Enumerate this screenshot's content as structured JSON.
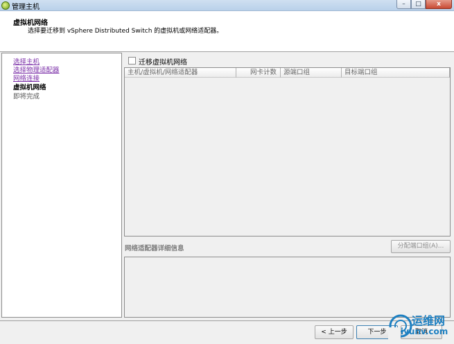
{
  "window": {
    "title": "管理主机",
    "controls": {
      "minimize": "–",
      "maximize": "□",
      "close": "x"
    }
  },
  "header": {
    "title": "虚拟机网络",
    "subtitle": "选择要迁移到 vSphere Distributed Switch 的虚拟机或网络适配器。"
  },
  "nav": {
    "items": [
      {
        "label": "选择主机",
        "state": "completed"
      },
      {
        "label": "选择物理适配器",
        "state": "completed"
      },
      {
        "label": "网络连接",
        "state": "completed"
      },
      {
        "label": "虚拟机网络",
        "state": "current"
      },
      {
        "label": "即将完成",
        "state": "upcoming"
      }
    ]
  },
  "migrate_checkbox": {
    "label": "迁移虚拟机网络",
    "checked": false
  },
  "table": {
    "columns": [
      "主机/虚拟机/网络适配器",
      "网卡计数",
      "源端口组",
      "目标端口组"
    ],
    "rows": []
  },
  "details": {
    "label": "网络适配器详细信息",
    "assign_button": "分配端口组(A)..."
  },
  "footer": {
    "back": "< 上一步",
    "next": "下一步",
    "cancel": "取消"
  },
  "watermark": {
    "line1": "运维网",
    "line2": "iyunv.com"
  },
  "colors": {
    "link_visited": "#7b2fa8",
    "titlebar": "#b9d1ea",
    "watermark": "#1c7fc1"
  }
}
